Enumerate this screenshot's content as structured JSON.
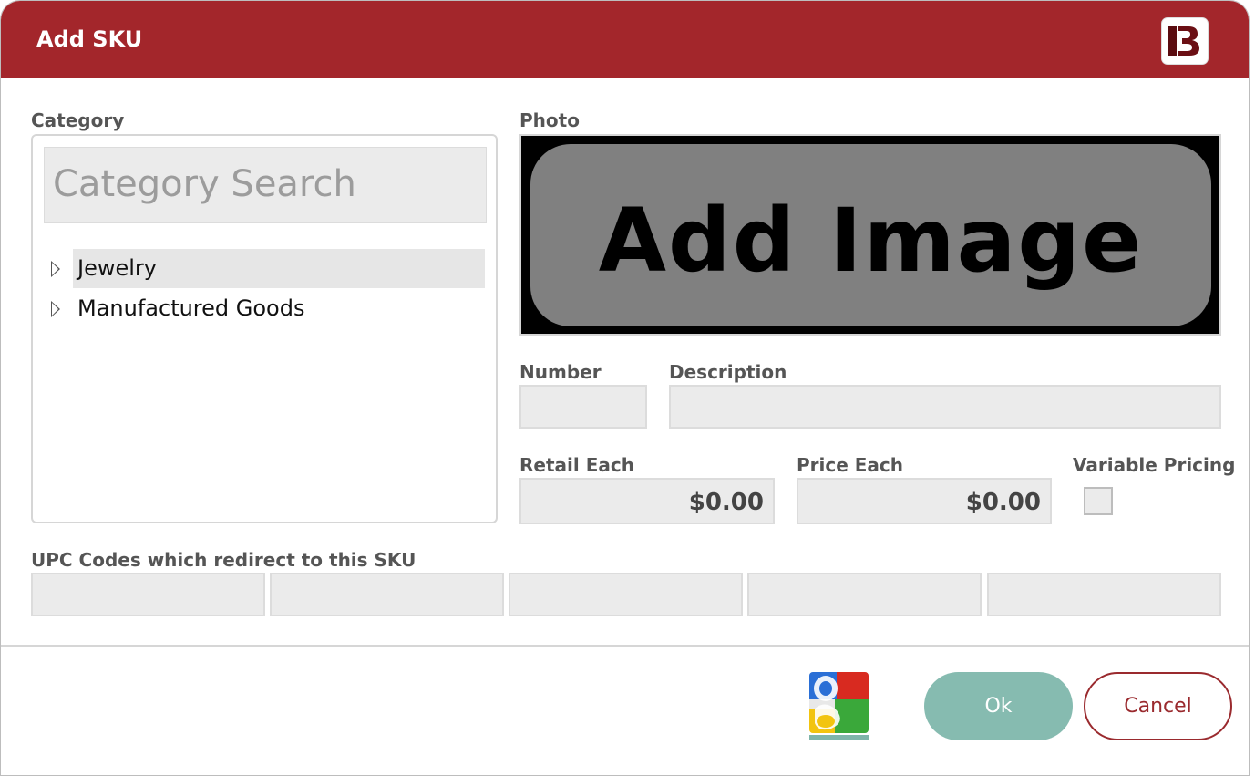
{
  "dialog": {
    "title": "Add SKU",
    "logo_text": "B"
  },
  "category": {
    "label": "Category",
    "search_placeholder": "Category Search",
    "items": [
      {
        "label": "Jewelry",
        "selected": true
      },
      {
        "label": "Manufactured Goods",
        "selected": false
      }
    ]
  },
  "photo": {
    "label": "Photo",
    "button_text": "Add Image"
  },
  "number": {
    "label": "Number",
    "value": ""
  },
  "description": {
    "label": "Description",
    "value": ""
  },
  "retail_each": {
    "label": "Retail Each",
    "value": "$0.00"
  },
  "price_each": {
    "label": "Price Each",
    "value": "$0.00"
  },
  "variable_pricing": {
    "label": "Variable Pricing",
    "checked": false
  },
  "upc": {
    "label": "UPC Codes which redirect to this SKU",
    "codes": [
      "",
      "",
      "",
      "",
      ""
    ]
  },
  "footer": {
    "ok_label": "Ok",
    "cancel_label": "Cancel",
    "google_icon": "google-icon"
  },
  "colors": {
    "titlebar": "#a3262b",
    "ok": "#86bbb0",
    "cancel_border": "#9a2a2e"
  }
}
